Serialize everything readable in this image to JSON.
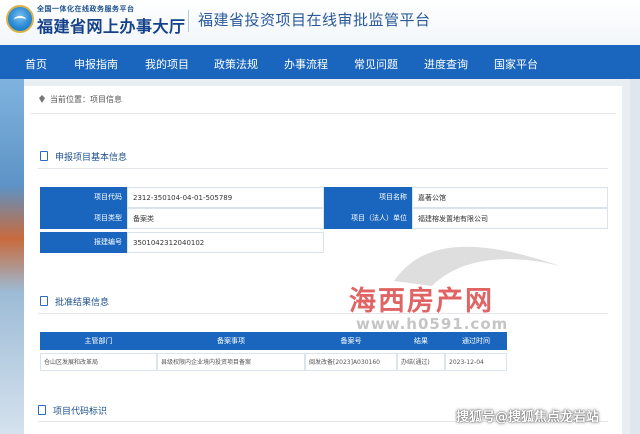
{
  "header": {
    "portal_subtitle": "全国一体化在线政务服务平台",
    "portal_name": "福建省网上办事大厅",
    "site_title": "福建省投资项目在线审批监管平台"
  },
  "nav": {
    "items": [
      "首页",
      "申报指南",
      "我的项目",
      "政策法规",
      "办事流程",
      "常见问题",
      "进度查询",
      "国家平台"
    ]
  },
  "breadcrumb": {
    "prefix": "当前位置：",
    "current": "项目信息"
  },
  "sections": {
    "basic_info": "申报项目基本信息",
    "approval_result": "批准结果信息",
    "code_label": "项目代码标识"
  },
  "basic_info": {
    "project_code_label": "项目代码",
    "project_code": "2312-350104-04-01-505789",
    "project_name_label": "项目名称",
    "project_name": "嘉著公馆",
    "project_type_label": "项目类型",
    "project_type": "备案类",
    "legal_unit_label": "项目（法人）单位",
    "legal_unit": "福建榕发置地有限公司",
    "filing_no_label": "报建编号",
    "filing_no": "3501042312040102"
  },
  "result_table": {
    "headers": [
      "主管部门",
      "备案事项",
      "备案号",
      "结果",
      "通过时间"
    ],
    "rows": [
      [
        "仓山区发展和改革局",
        "县级权限内企业境内投资项目备案",
        "闽发改备[2023]A030160",
        "办结(通过)",
        "2023-12-04"
      ]
    ]
  },
  "watermarks": {
    "logo": "海西房产网",
    "url": "www.h0591.com",
    "source": "搜狐号@搜狐焦点龙岩站"
  },
  "colors": {
    "nav_blue": "#1a66be",
    "title_blue": "#1a4f8c",
    "watermark_red": "#d63030"
  }
}
